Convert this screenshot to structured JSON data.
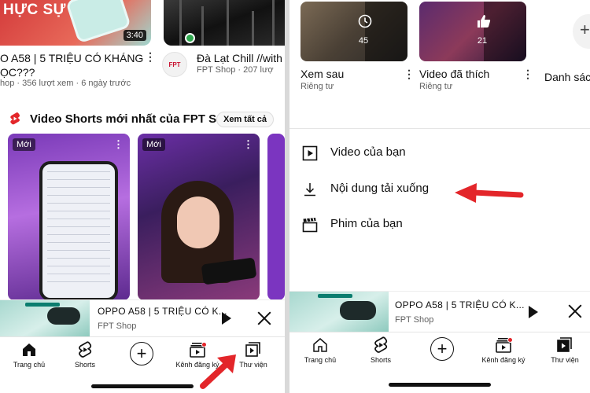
{
  "left": {
    "videos": [
      {
        "thumb_headline": "HỰC SỰ",
        "duration": "3:40",
        "title": "O A58 | 5 TRIỆU CÓ KHÁNG",
        "title_line2": "ỌC???",
        "meta": "hop · 356 lượt xem · 6 ngày trước"
      },
      {
        "channel_avatar": "FPT",
        "title": "Đà Lạt Chill //with",
        "meta": "FPT Shop · 207 lượ"
      }
    ],
    "shorts": {
      "icon": "youtube-shorts-icon",
      "title": "Video Shorts mới nhất của FPT S...",
      "see_all": "Xem tất cả",
      "items": [
        {
          "badge": "Mới"
        },
        {
          "badge": "Mới"
        }
      ]
    },
    "mini_player": {
      "title": "OPPO A58 | 5 TRIỆU CÓ K...",
      "channel": "FPT Shop"
    },
    "nav": [
      {
        "label": "Trang chủ",
        "icon": "home-icon"
      },
      {
        "label": "Shorts",
        "icon": "shorts-icon"
      },
      {
        "label": "",
        "icon": "create-plus-icon"
      },
      {
        "label": "Kênh đăng ký",
        "icon": "subscriptions-icon"
      },
      {
        "label": "Thư viện",
        "icon": "library-icon"
      }
    ]
  },
  "right": {
    "playlists": [
      {
        "title": "Xem sau",
        "subtitle": "Riêng tư",
        "count": "45",
        "icon": "clock-icon"
      },
      {
        "title": "Video đã thích",
        "subtitle": "Riêng tư",
        "count": "21",
        "icon": "thumbs-up-icon"
      },
      {
        "title": "Danh sác",
        "icon": "add-playlist-icon"
      }
    ],
    "menu": [
      {
        "label": "Video của bạn",
        "icon": "play-square-icon"
      },
      {
        "label": "Nội dung tải xuống",
        "icon": "download-icon"
      },
      {
        "label": "Phim của bạn",
        "icon": "clapperboard-icon"
      }
    ],
    "mini_player": {
      "title": "OPPO A58 | 5 TRIỆU CÓ K...",
      "channel": "FPT Shop"
    },
    "nav": [
      {
        "label": "Trang chủ",
        "icon": "home-icon"
      },
      {
        "label": "Shorts",
        "icon": "shorts-icon"
      },
      {
        "label": "",
        "icon": "create-plus-icon"
      },
      {
        "label": "Kênh đăng ký",
        "icon": "subscriptions-icon"
      },
      {
        "label": "Thư viện",
        "icon": "library-icon"
      }
    ]
  },
  "colors": {
    "annotation_arrow": "#e3262a",
    "youtube_red": "#e3262a",
    "shorts_purple": "#7b35c0"
  }
}
